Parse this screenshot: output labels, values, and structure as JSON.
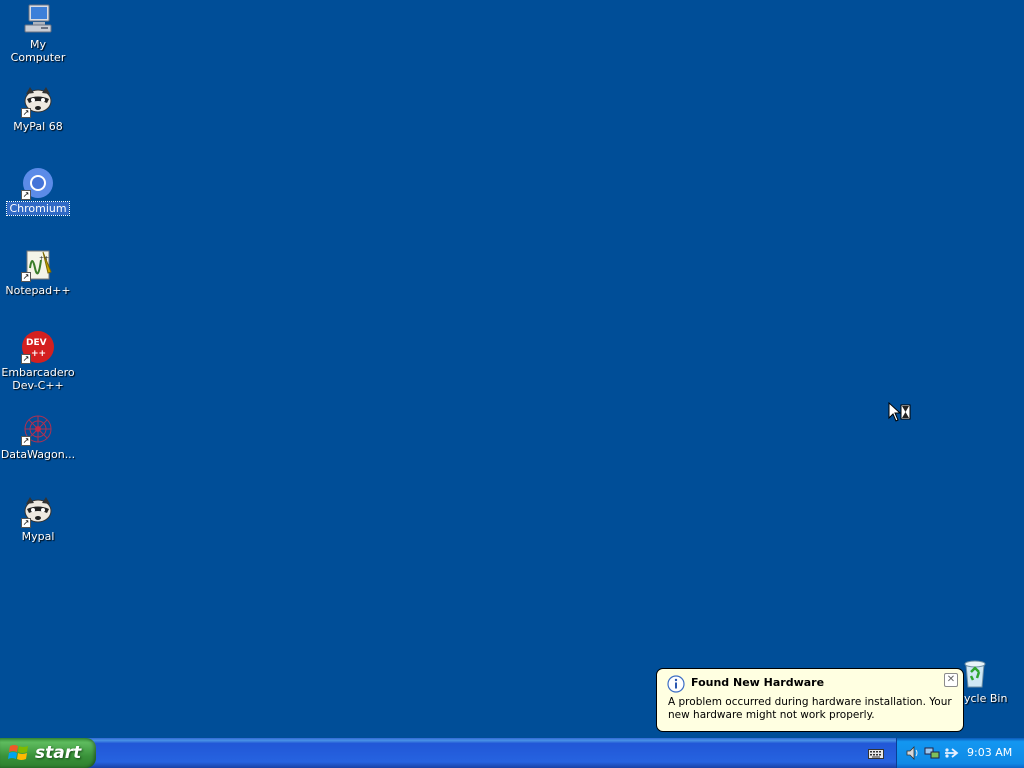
{
  "desktop": {
    "background_color": "#004E98",
    "icons": [
      {
        "label": "My Computer",
        "icon": "my-computer-icon",
        "shortcut": false
      },
      {
        "label": "MyPal 68",
        "icon": "mypal-raccoon-icon",
        "shortcut": true
      },
      {
        "label": "Chromium",
        "icon": "chromium-icon",
        "shortcut": true,
        "selected": true
      },
      {
        "label": "Notepad++",
        "icon": "notepadpp-icon",
        "shortcut": true
      },
      {
        "label": "Embarcadero\nDev-C++",
        "icon": "devcpp-icon",
        "shortcut": true
      },
      {
        "label": "DataWagon...",
        "icon": "datawagon-icon",
        "shortcut": true
      },
      {
        "label": "Mypal",
        "icon": "mypal-raccoon-icon",
        "shortcut": true
      },
      {
        "label": "ycle Bin",
        "icon": "recycle-bin-icon",
        "shortcut": false
      }
    ]
  },
  "balloon": {
    "title": "Found New Hardware",
    "message": "A problem occurred during hardware installation. Your new hardware might not work properly.",
    "close_symbol": "✕",
    "info_icon": "info-icon"
  },
  "taskbar": {
    "start_label": "start",
    "clock": "9:03 AM",
    "tray_icons": [
      "speaker-icon",
      "network-icon",
      "safely-remove-icon"
    ],
    "language_icon": "keyboard-icon"
  }
}
